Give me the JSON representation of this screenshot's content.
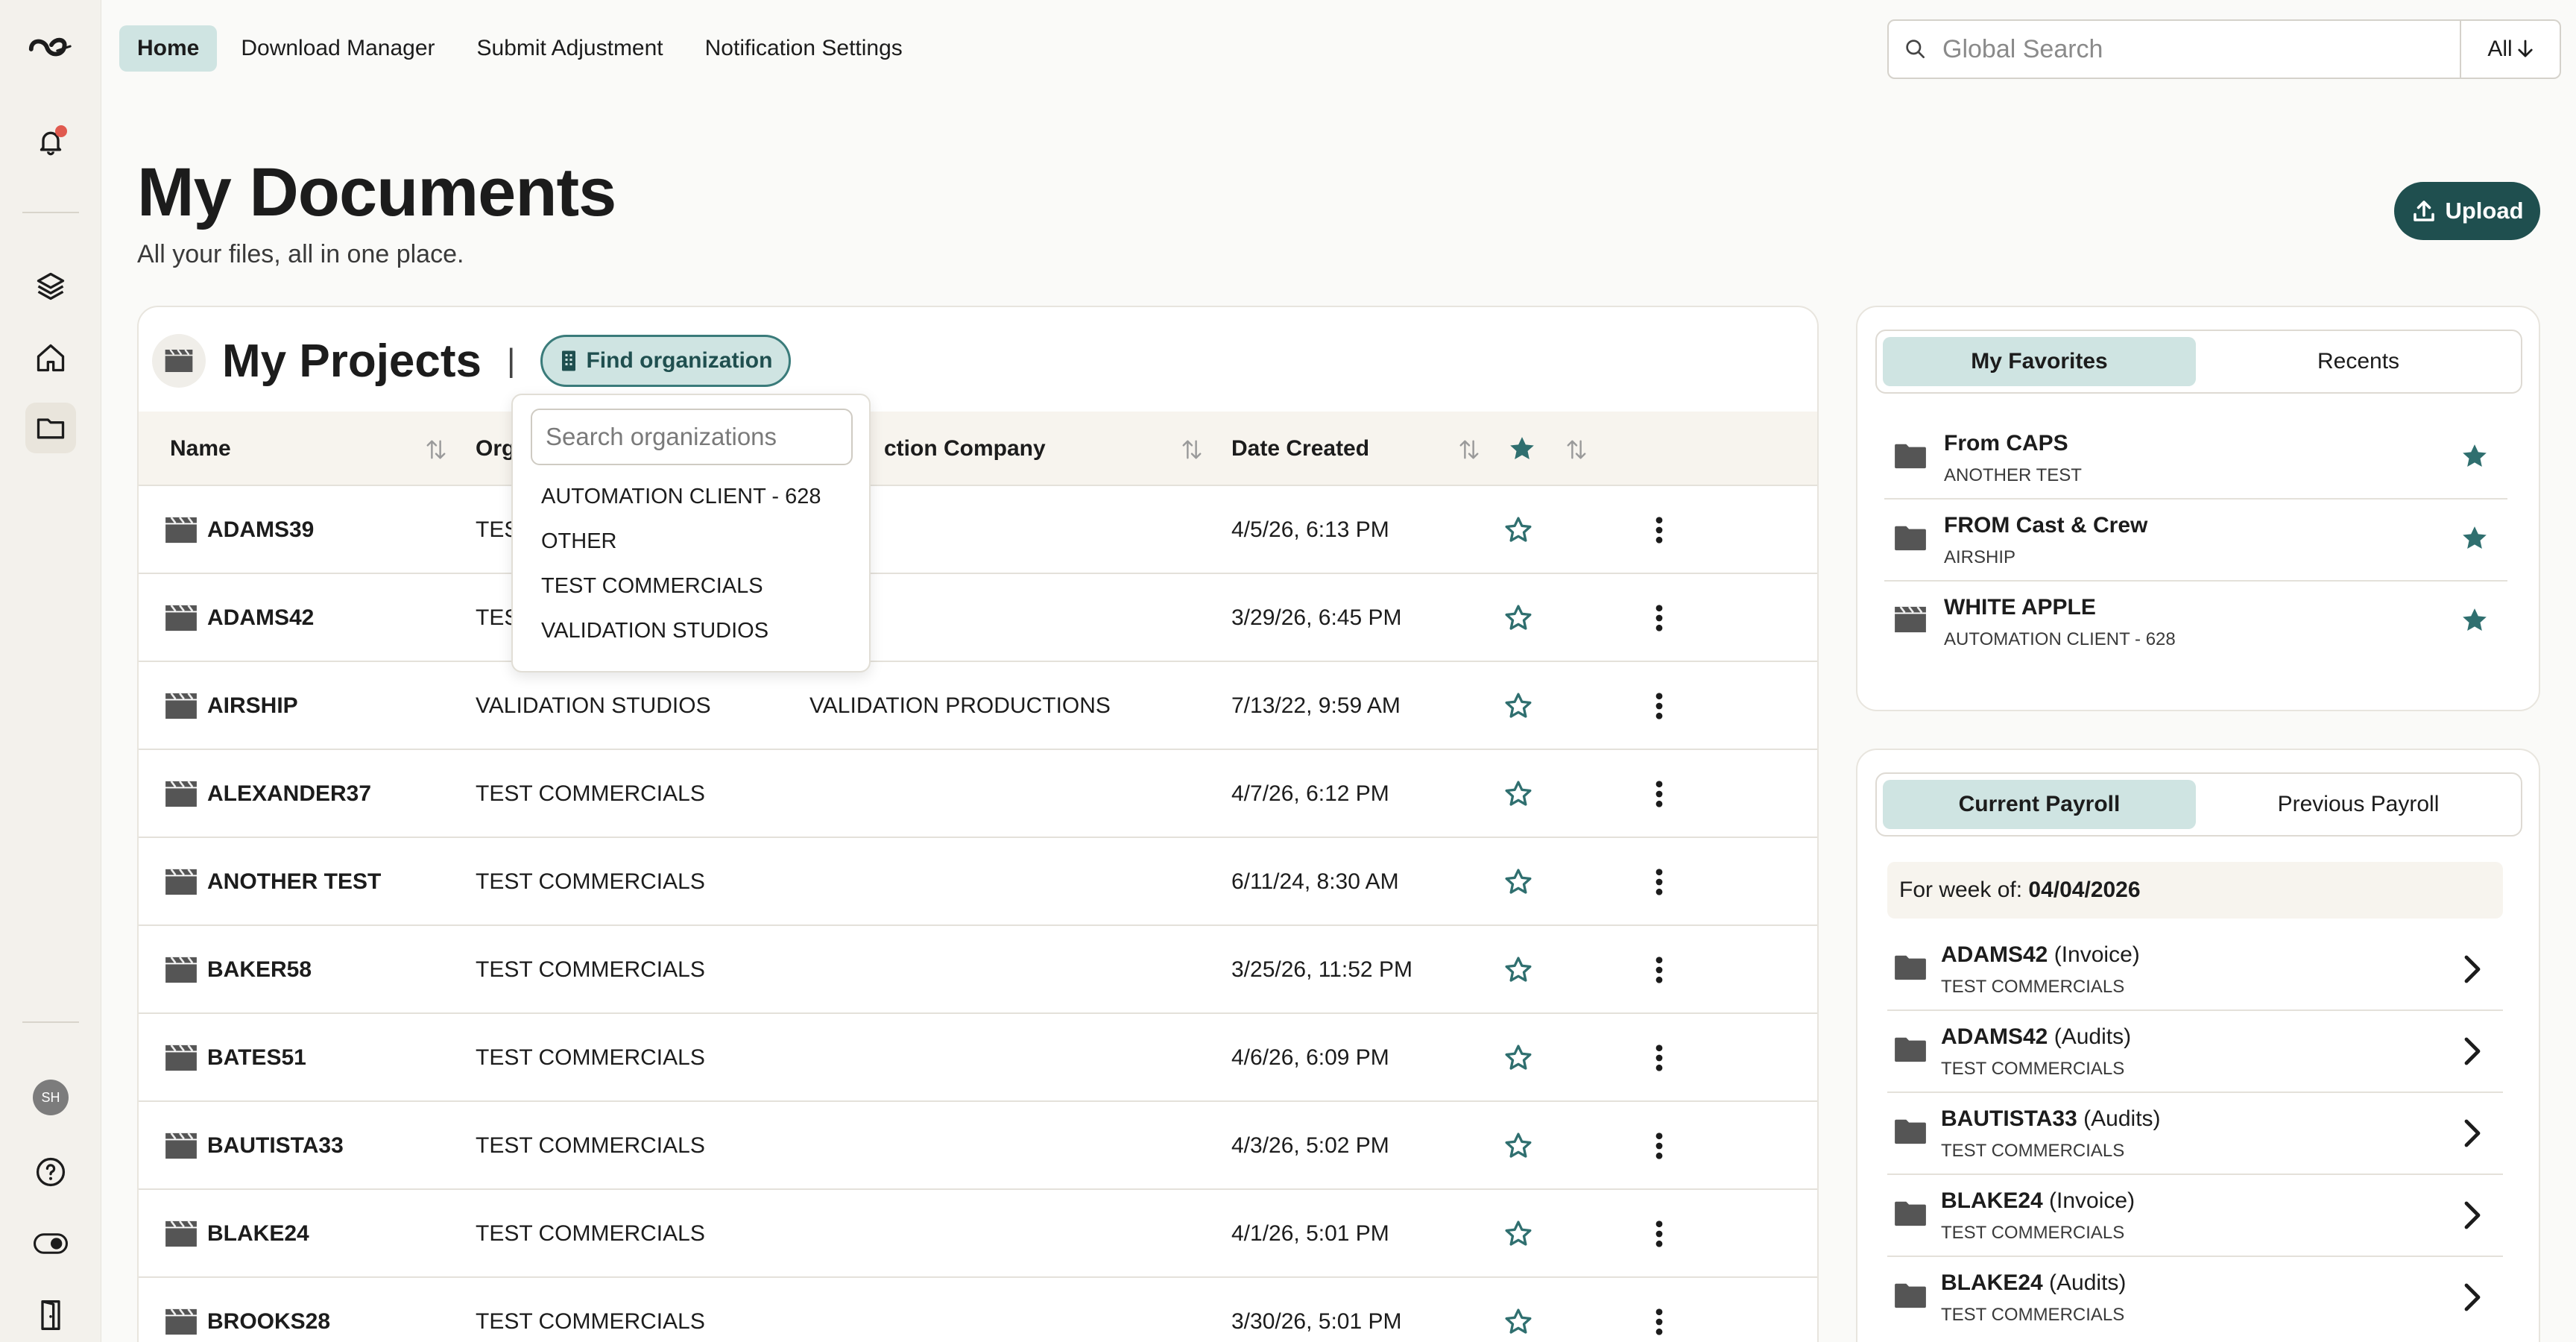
{
  "nav": {
    "tabs": [
      {
        "label": "Home",
        "active": true
      },
      {
        "label": "Download Manager"
      },
      {
        "label": "Submit Adjustment"
      },
      {
        "label": "Notification Settings"
      }
    ]
  },
  "search": {
    "placeholder": "Global Search",
    "scope": "All"
  },
  "sidebar": {
    "avatar_initials": "SH"
  },
  "header": {
    "title": "My Documents",
    "subtitle": "All your files, all in one place.",
    "upload_label": "Upload"
  },
  "projects": {
    "title": "My Projects",
    "find_org_label": "Find organization",
    "columns": {
      "name": "Name",
      "org": "Org",
      "production": "ction Company",
      "date": "Date Created"
    },
    "rows": [
      {
        "name": "ADAMS39",
        "org": "TES",
        "production": "",
        "date": "4/5/26, 6:13 PM"
      },
      {
        "name": "ADAMS42",
        "org": "TES",
        "production": "",
        "date": "3/29/26, 6:45 PM"
      },
      {
        "name": "AIRSHIP",
        "org": "VALIDATION STUDIOS",
        "production": "VALIDATION PRODUCTIONS",
        "date": "7/13/22, 9:59 AM"
      },
      {
        "name": "ALEXANDER37",
        "org": "TEST COMMERCIALS",
        "production": "",
        "date": "4/7/26, 6:12 PM"
      },
      {
        "name": "ANOTHER TEST",
        "org": "TEST COMMERCIALS",
        "production": "",
        "date": "6/11/24, 8:30 AM"
      },
      {
        "name": "BAKER58",
        "org": "TEST COMMERCIALS",
        "production": "",
        "date": "3/25/26, 11:52 PM"
      },
      {
        "name": "BATES51",
        "org": "TEST COMMERCIALS",
        "production": "",
        "date": "4/6/26, 6:09 PM"
      },
      {
        "name": "BAUTISTA33",
        "org": "TEST COMMERCIALS",
        "production": "",
        "date": "4/3/26, 5:02 PM"
      },
      {
        "name": "BLAKE24",
        "org": "TEST COMMERCIALS",
        "production": "",
        "date": "4/1/26, 5:01 PM"
      },
      {
        "name": "BROOKS28",
        "org": "TEST COMMERCIALS",
        "production": "",
        "date": "3/30/26, 5:01 PM"
      }
    ]
  },
  "org_dropdown": {
    "placeholder": "Search organizations",
    "options": [
      "AUTOMATION CLIENT - 628",
      "OTHER",
      "TEST COMMERCIALS",
      "VALIDATION STUDIOS"
    ]
  },
  "favorites": {
    "tabs": [
      "My Favorites",
      "Recents"
    ],
    "items": [
      {
        "title": "From CAPS",
        "subtitle": "ANOTHER TEST",
        "icon": "folder-icon"
      },
      {
        "title": "FROM Cast & Crew",
        "subtitle": "AIRSHIP",
        "icon": "folder-icon"
      },
      {
        "title": "WHITE APPLE",
        "subtitle": "AUTOMATION CLIENT - 628",
        "icon": "clapperboard-icon"
      }
    ]
  },
  "payroll": {
    "tabs": [
      "Current Payroll",
      "Previous Payroll"
    ],
    "week_label": "For week of:",
    "week_value": "04/04/2026",
    "items": [
      {
        "title": "ADAMS42",
        "kind": "(Invoice)",
        "subtitle": "TEST COMMERCIALS"
      },
      {
        "title": "ADAMS42",
        "kind": "(Audits)",
        "subtitle": "TEST COMMERCIALS"
      },
      {
        "title": "BAUTISTA33",
        "kind": "(Audits)",
        "subtitle": "TEST COMMERCIALS"
      },
      {
        "title": "BLAKE24",
        "kind": "(Invoice)",
        "subtitle": "TEST COMMERCIALS"
      },
      {
        "title": "BLAKE24",
        "kind": "(Audits)",
        "subtitle": "TEST COMMERCIALS"
      }
    ]
  },
  "colors": {
    "accent": "#1f4f4f",
    "accent_light": "#cfe4e2",
    "star": "#2f6f6f",
    "notification": "#e05a4f"
  }
}
